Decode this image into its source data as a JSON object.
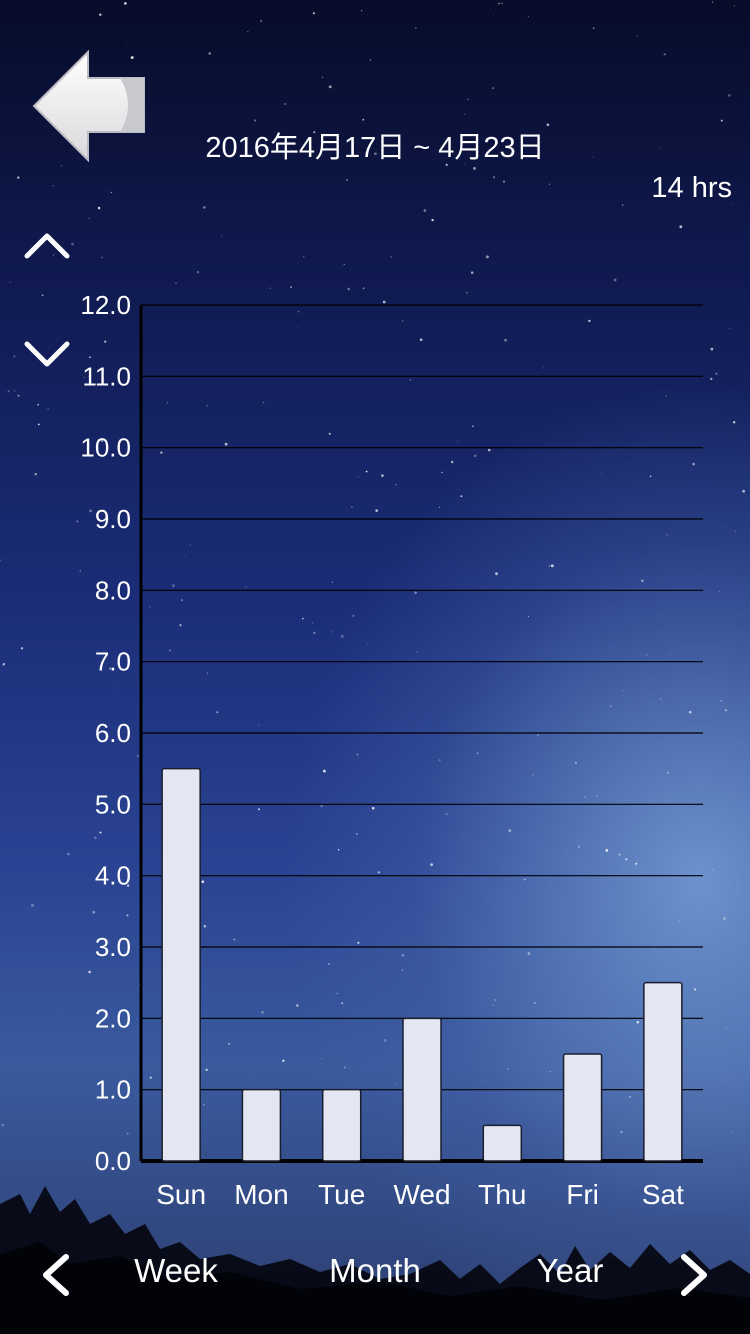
{
  "header": {
    "date_range": "2016年4月17日 ~ 4月23日",
    "total_hours": "14 hrs"
  },
  "controls": {
    "back_icon": "back-arrow-icon",
    "scale_up_icon": "chevron-up-icon",
    "scale_down_icon": "chevron-down-icon"
  },
  "chart_data": {
    "type": "bar",
    "categories": [
      "Sun",
      "Mon",
      "Tue",
      "Wed",
      "Thu",
      "Fri",
      "Sat"
    ],
    "values": [
      5.5,
      1.0,
      1.0,
      2.0,
      0.5,
      1.5,
      2.5
    ],
    "ylim": [
      0,
      12
    ],
    "yticks": [
      "0.0",
      "1.0",
      "2.0",
      "3.0",
      "4.0",
      "5.0",
      "6.0",
      "7.0",
      "8.0",
      "9.0",
      "10.0",
      "11.0",
      "12.0"
    ],
    "grid": true,
    "bar_color": "#e4e6f2",
    "title": "",
    "xlabel": "",
    "ylabel": ""
  },
  "range_selector": {
    "tabs": [
      "Week",
      "Month",
      "Year"
    ],
    "prev_icon": "chevron-left-icon",
    "next_icon": "chevron-right-icon"
  }
}
